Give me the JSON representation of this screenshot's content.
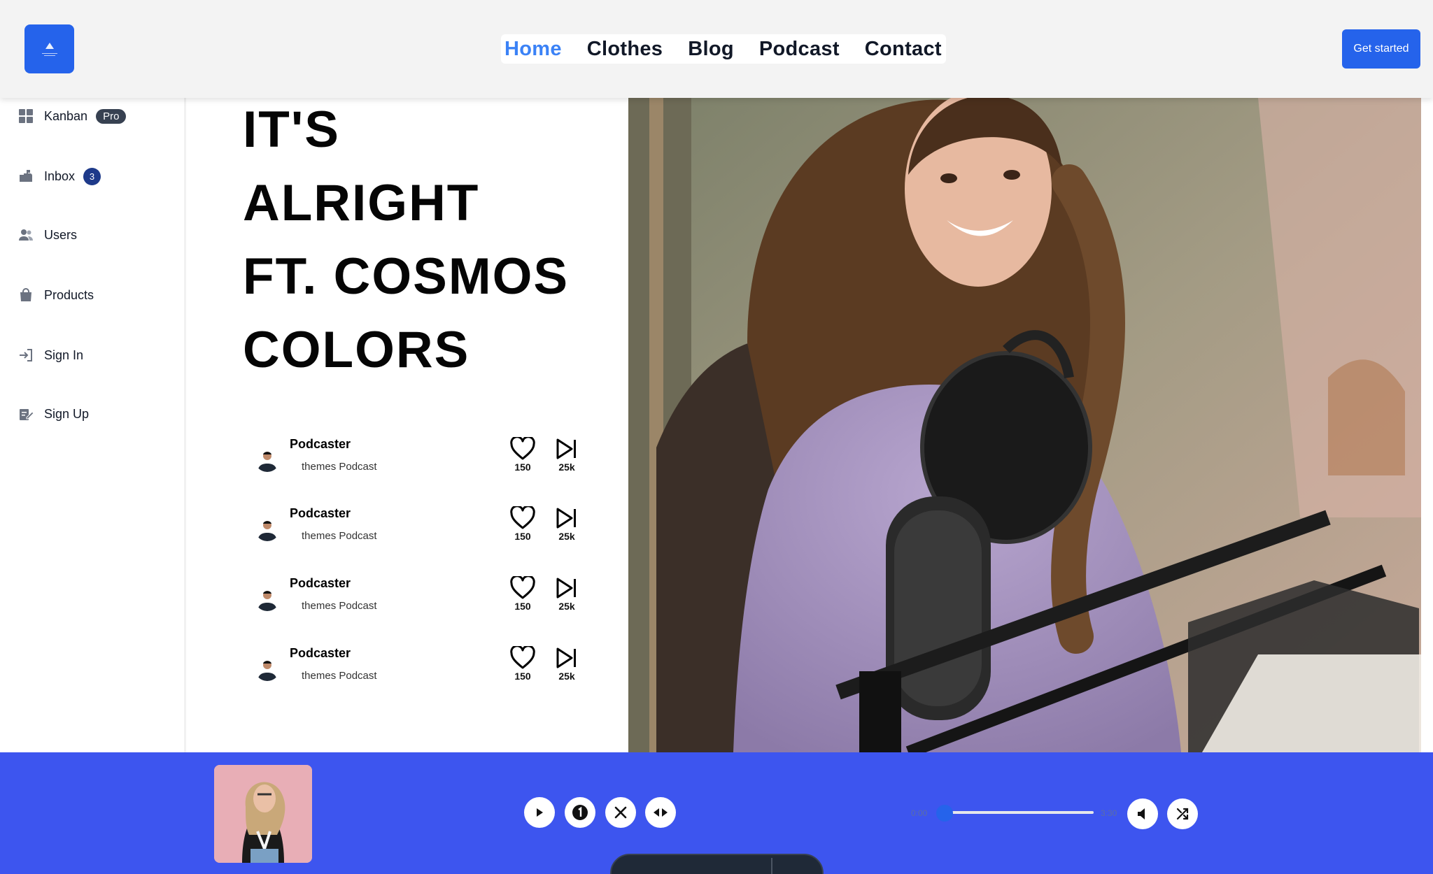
{
  "header": {
    "nav": [
      {
        "label": "Home",
        "active": true
      },
      {
        "label": "Clothes",
        "active": false
      },
      {
        "label": "Blog",
        "active": false
      },
      {
        "label": "Podcast",
        "active": false
      },
      {
        "label": "Contact",
        "active": false
      }
    ],
    "cta_label": "Get started"
  },
  "sidebar": {
    "items": [
      {
        "label": "Kanban",
        "icon": "grid-icon",
        "badge": "Pro"
      },
      {
        "label": "Inbox",
        "icon": "inbox-icon",
        "count": "3"
      },
      {
        "label": "Users",
        "icon": "users-icon"
      },
      {
        "label": "Products",
        "icon": "shopping-bag-icon"
      },
      {
        "label": "Sign In",
        "icon": "sign-in-icon"
      },
      {
        "label": "Sign Up",
        "icon": "sign-up-icon"
      }
    ]
  },
  "hero": {
    "title_lines": [
      "IT'S",
      "ALRIGHT",
      "FT. COSMOS",
      "COLORS"
    ]
  },
  "tracks": [
    {
      "name": "Podcaster",
      "subtitle": "themes Podcast",
      "likes": "150",
      "plays": "25k"
    },
    {
      "name": "Podcaster",
      "subtitle": "themes Podcast",
      "likes": "150",
      "plays": "25k"
    },
    {
      "name": "Podcaster",
      "subtitle": "themes Podcast",
      "likes": "150",
      "plays": "25k"
    },
    {
      "name": "Podcaster",
      "subtitle": "themes Podcast",
      "likes": "150",
      "plays": "25k"
    }
  ],
  "player": {
    "time_current": "0:00",
    "time_total": "3:30",
    "progress_fraction": 0,
    "controls": [
      "play-icon",
      "number-one-icon",
      "close-icon",
      "arrows-horizontal-icon"
    ],
    "right_controls": [
      "volume-icon",
      "shuffle-icon"
    ]
  },
  "colors": {
    "accent": "#2563eb",
    "nav_active": "#3b82f6",
    "player_bg": "#3d55ef",
    "header_bg": "#f3f3f3"
  }
}
